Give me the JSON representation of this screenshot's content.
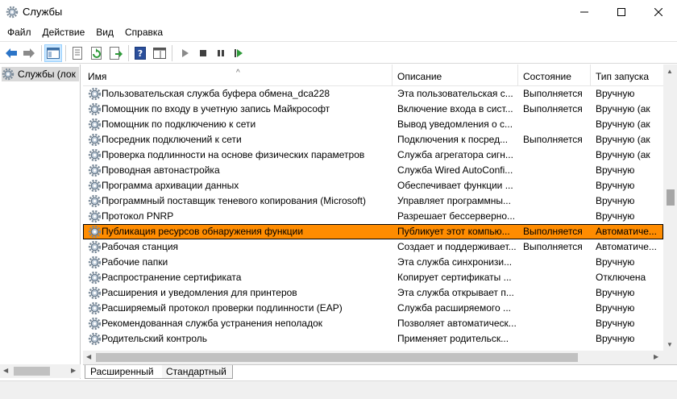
{
  "window": {
    "title": "Службы"
  },
  "menu": [
    "Файл",
    "Действие",
    "Вид",
    "Справка"
  ],
  "tree": {
    "root_label": "Службы (лок"
  },
  "columns": {
    "name": "Имя",
    "description": "Описание",
    "state": "Состояние",
    "startup": "Тип запуска"
  },
  "services": [
    {
      "name": "Пользовательская служба буфера обмена_dca228",
      "description": "Эта пользовательская с...",
      "state": "Выполняется",
      "startup": "Вручную"
    },
    {
      "name": "Помощник по входу в учетную запись Майкрософт",
      "description": "Включение входа в сист...",
      "state": "Выполняется",
      "startup": "Вручную (ак"
    },
    {
      "name": "Помощник по подключению к сети",
      "description": "Вывод уведомления о с...",
      "state": "",
      "startup": "Вручную (ак"
    },
    {
      "name": "Посредник подключений к сети",
      "description": "Подключения к посред...",
      "state": "Выполняется",
      "startup": "Вручную (ак"
    },
    {
      "name": "Проверка подлинности на основе физических параметров",
      "description": "Служба агрегатора сигн...",
      "state": "",
      "startup": "Вручную (ак"
    },
    {
      "name": "Проводная автонастройка",
      "description": "Служба Wired AutoConfi...",
      "state": "",
      "startup": "Вручную"
    },
    {
      "name": "Программа архивации данных",
      "description": "Обеспечивает функции ...",
      "state": "",
      "startup": "Вручную"
    },
    {
      "name": "Программный поставщик теневого копирования (Microsoft)",
      "description": "Управляет программны...",
      "state": "",
      "startup": "Вручную"
    },
    {
      "name": "Протокол PNRP",
      "description": "Разрешает бессерверно...",
      "state": "",
      "startup": "Вручную"
    },
    {
      "name": "Публикация ресурсов обнаружения функции",
      "description": "Публикует этот компью...",
      "state": "Выполняется",
      "startup": "Автоматиче..."
    },
    {
      "name": "Рабочая станция",
      "description": "Создает и поддерживает...",
      "state": "Выполняется",
      "startup": "Автоматиче..."
    },
    {
      "name": "Рабочие папки",
      "description": "Эта служба синхронизи...",
      "state": "",
      "startup": "Вручную"
    },
    {
      "name": "Распространение сертификата",
      "description": "Копирует сертификаты ...",
      "state": "",
      "startup": "Отключена"
    },
    {
      "name": "Расширения и уведомления для принтеров",
      "description": "Эта служба открывает п...",
      "state": "",
      "startup": "Вручную"
    },
    {
      "name": "Расширяемый протокол проверки подлинности (EAP)",
      "description": "Служба расширяемого ...",
      "state": "",
      "startup": "Вручную"
    },
    {
      "name": "Рекомендованная служба устранения неполадок",
      "description": "Позволяет автоматическ...",
      "state": "",
      "startup": "Вручную"
    },
    {
      "name": "Родительский контроль",
      "description": "Применяет родительск...",
      "state": "",
      "startup": "Вручную"
    }
  ],
  "selected_index": 9,
  "tabs": {
    "extended": "Расширенный",
    "standard": "Стандартный"
  },
  "colors": {
    "selection": "#ff8c00",
    "hover": "#cce8ff",
    "nav_arrow": "#2b74c7"
  }
}
